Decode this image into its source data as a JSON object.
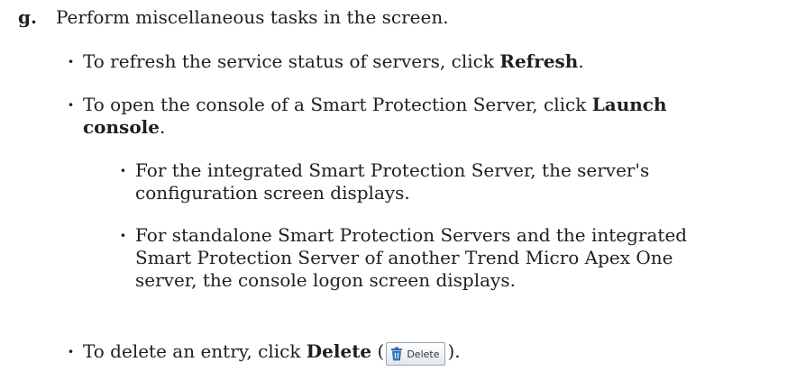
{
  "step": {
    "marker": "g.",
    "text": "Perform miscellaneous tasks in the screen."
  },
  "items": {
    "refresh": {
      "before": "To refresh the service status of servers, click ",
      "bold": "Refresh",
      "after": "."
    },
    "launch": {
      "before": "To open the console of a Smart Protection Server, click ",
      "bold_line1": "Launch",
      "bold_line2": "console",
      "after": "."
    },
    "integrated": {
      "line1": "For the integrated Smart Protection Server, the server's",
      "line2": "configuration screen displays."
    },
    "standalone": {
      "line1": "For standalone Smart Protection Servers and the integrated",
      "line2": "Smart Protection Server of another Trend Micro Apex One",
      "line3": "server, the console logon screen displays."
    },
    "delete": {
      "before": "To delete an entry, click ",
      "bold": "Delete",
      "open_paren": " (",
      "button_label": "Delete",
      "close_paren": ")."
    }
  },
  "icons": {
    "bullet": "bullet-dot",
    "delete": "trash-icon"
  },
  "colors": {
    "text": "#1f1f1f",
    "trash_icon": "#2a6fb5"
  }
}
